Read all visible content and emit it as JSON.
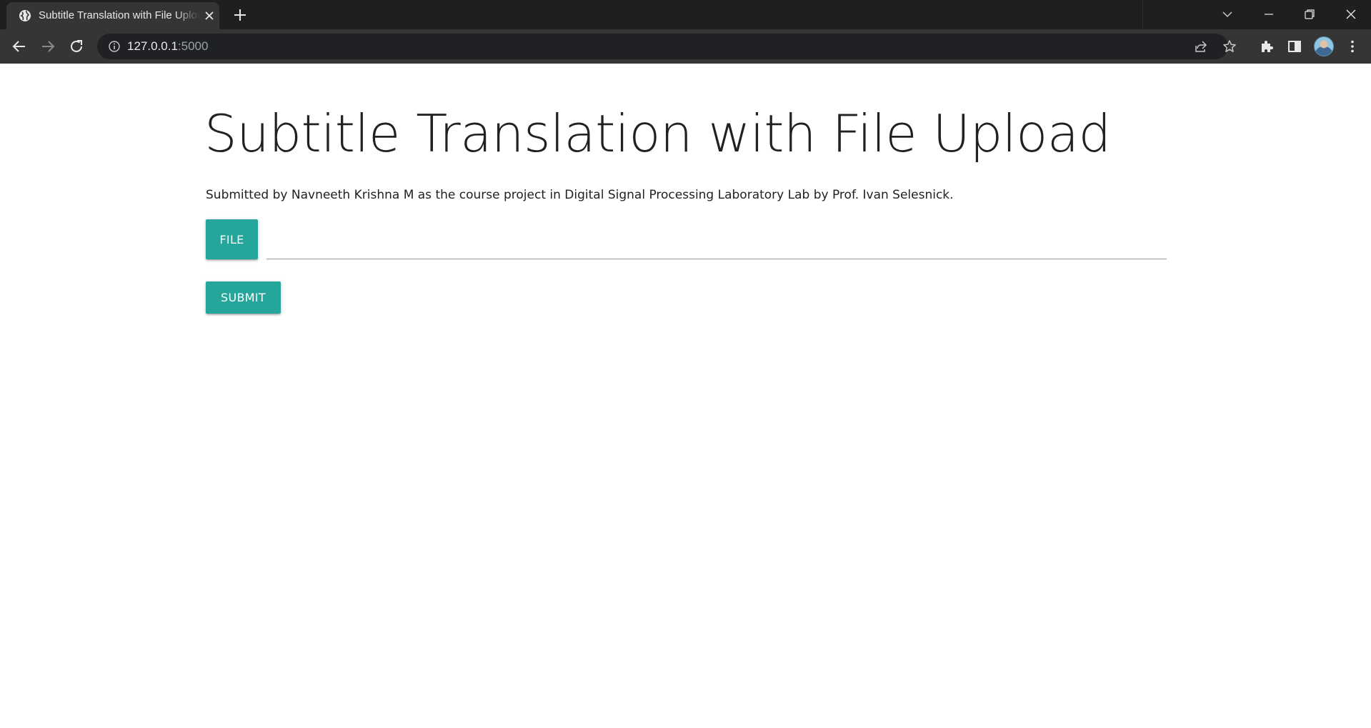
{
  "browser": {
    "tab_title": "Subtitle Translation with File Upload",
    "url_host": "127.0.0.1",
    "url_port": ":5000",
    "icons": {
      "favicon": "globe-icon",
      "tab_close": "close-icon",
      "new_tab": "plus-icon",
      "tab_search": "chevron-down-icon",
      "minimize": "minimize-icon",
      "restore": "restore-icon",
      "close_window": "close-icon",
      "back": "back-arrow-icon",
      "forward": "forward-arrow-icon",
      "reload": "reload-icon",
      "site_info": "info-icon",
      "share": "share-icon",
      "bookmark": "star-icon",
      "extensions": "puzzle-icon",
      "side_panel": "side-panel-icon",
      "menu": "kebab-menu-icon"
    }
  },
  "page": {
    "heading": "Subtitle Translation with File Upload",
    "subtitle": "Submitted by Navneeth Krishna M as the course project in Digital Signal Processing Laboratory Lab by Prof. Ivan Selesnick.",
    "file_button_label": "File",
    "file_path_value": "",
    "submit_label": "Submit",
    "accent_color": "#26a69a"
  }
}
